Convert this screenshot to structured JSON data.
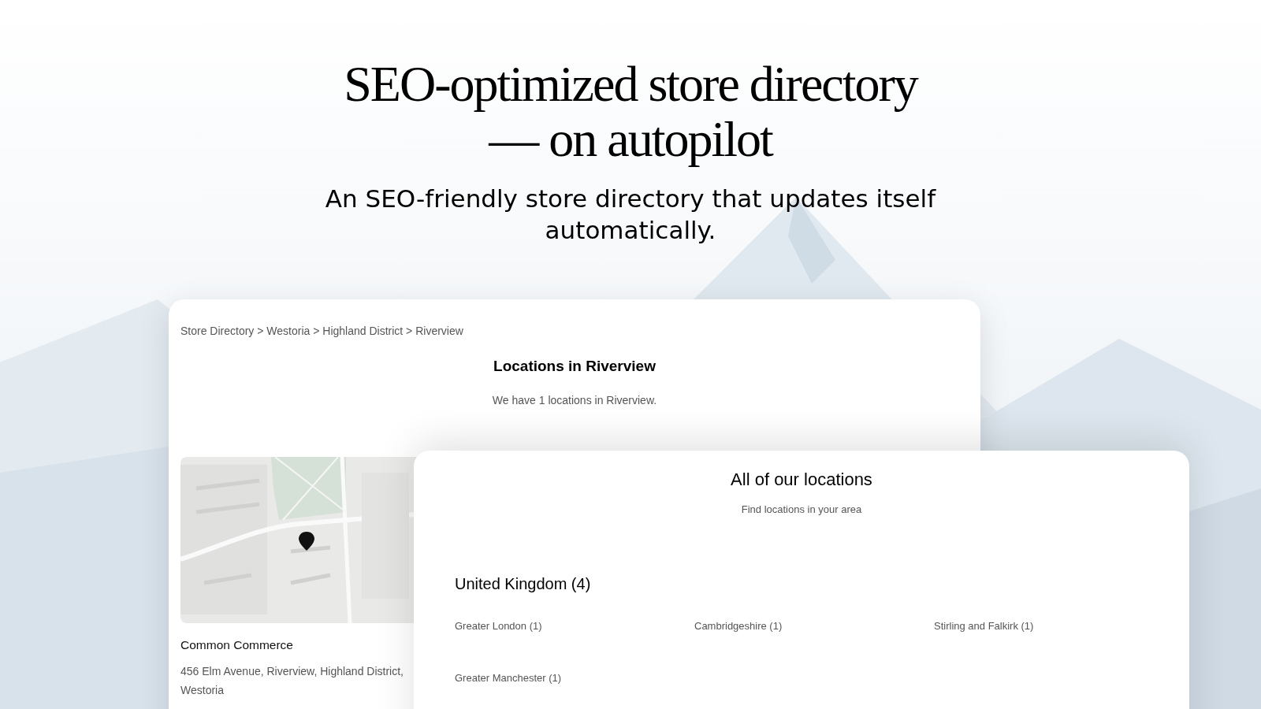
{
  "hero": {
    "title_lines": [
      "SEO-optimized store directory",
      "— on autopilot"
    ],
    "subtitle": "An SEO-friendly store directory that updates itself automatically."
  },
  "city_page": {
    "breadcrumb": {
      "separator": ">",
      "items": [
        "Store Directory",
        "Westoria",
        "Highland District",
        "Riverview"
      ]
    },
    "heading": "Locations in Riverview",
    "subheading": "We have 1 locations in Riverview.",
    "store": {
      "name": "Common Commerce",
      "address": "456 Elm Avenue, Riverview, Highland District, Westoria"
    }
  },
  "directory_page": {
    "heading": "All of our locations",
    "subheading": "Find locations in your area",
    "countries": [
      {
        "name": "United Kingdom (4)",
        "regions": [
          "Greater London (1)",
          "Cambridgeshire (1)",
          "Stirling and Falkirk (1)",
          "Greater Manchester (1)"
        ]
      }
    ]
  }
}
